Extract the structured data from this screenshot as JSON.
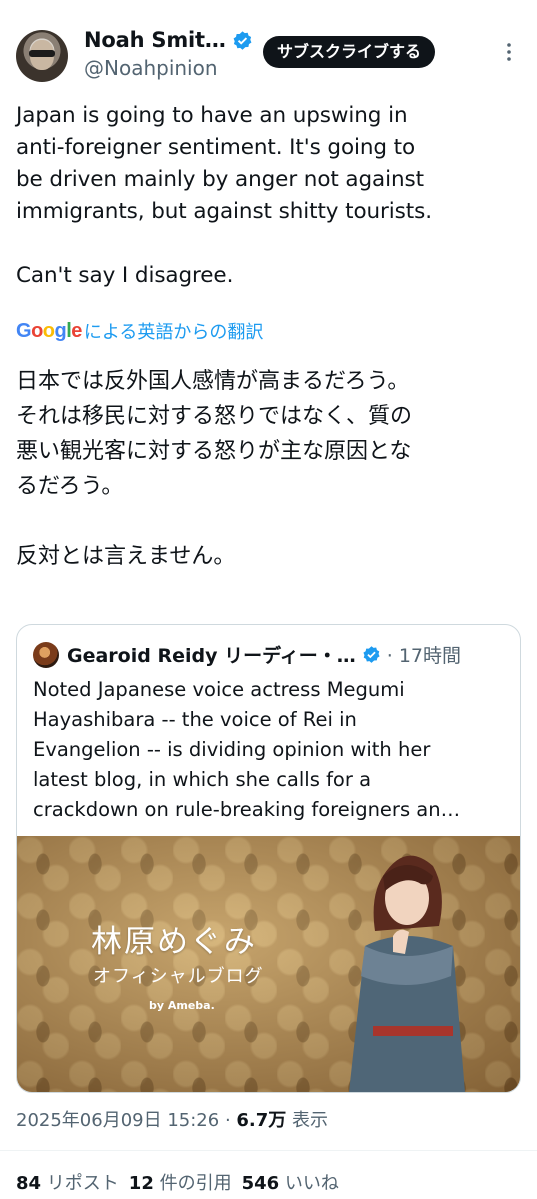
{
  "author": {
    "name": "Noah Smit…",
    "handle": "@Noahpinion",
    "subscribe_label": "サブスクライブする"
  },
  "tweet": {
    "text": "Japan is going to have an upswing in\nanti-foreigner sentiment. It's going to\nbe driven mainly by anger not against\nimmigrants, but against shitty tourists.\n\nCan't say I disagree.",
    "translate_brand": "Google",
    "translate_label": "による英語からの翻訳",
    "translated_text": "日本では反外国人感情が高まるだろう。\nそれは移民に対する怒りではなく、質の\n悪い観光客に対する怒りが主な原因とな\nるだろう。\n\n反対とは言えません。"
  },
  "quote": {
    "name": "Gearoid Reidy リーディー・…",
    "time": "· 17時間",
    "text": "Noted Japanese voice actress Megumi\nHayashibara -- the voice of Rei in\nEvangelion -- is dividing opinion with her\nlatest blog, in which she calls for a\ncrackdown on rule-breaking foreigners an…",
    "image": {
      "title": "林原めぐみ",
      "subtitle": "オフィシャルブログ",
      "brand": "by Ameba."
    }
  },
  "meta": {
    "timestamp": "2025年06月09日 15:26",
    "separator": " · ",
    "views": "6.7万",
    "views_label": " 表示"
  },
  "stats": {
    "reposts": "84",
    "reposts_label": "リポスト",
    "quotes": "12",
    "quotes_label": "件の引用",
    "likes": "546",
    "likes_label": "いいね"
  },
  "colors": {
    "accent": "#1d9bf0",
    "text": "#0f1419",
    "muted": "#536471",
    "border": "#cfd9de"
  },
  "icons": [
    "verified-badge-icon",
    "more-options-icon",
    "google-logo"
  ]
}
